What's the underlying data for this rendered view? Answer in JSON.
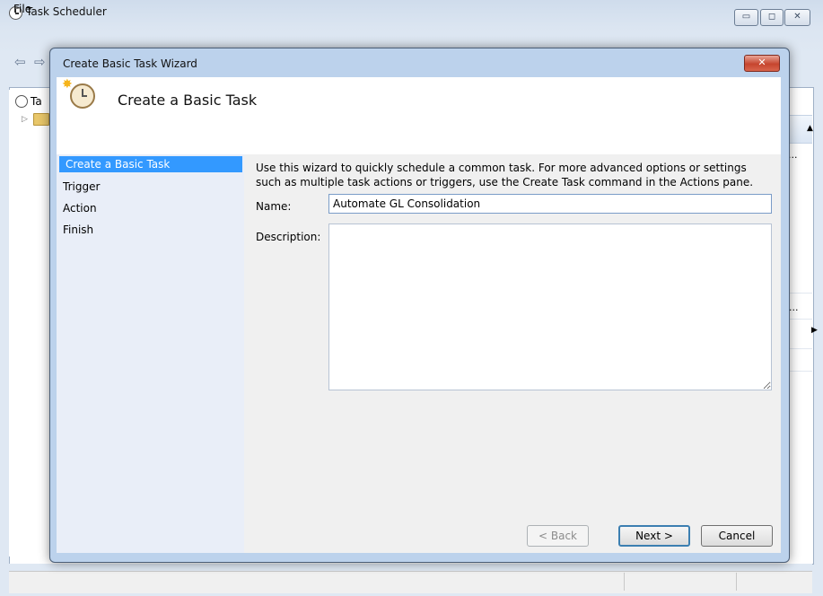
{
  "main_window": {
    "title": "Task Scheduler",
    "min_label": "▭",
    "max_label": "◻",
    "close_label": "✕",
    "menu": {
      "file": "File"
    },
    "tree": {
      "root_label": "Ta",
      "expander": "▷"
    },
    "actions": {
      "collapse": "▲",
      "ellipsis": "...",
      "submenu": "▶"
    }
  },
  "wizard": {
    "title": "Create Basic Task Wizard",
    "close_label": "✕",
    "header_title": "Create a Basic Task",
    "header_star": "✸",
    "nav": [
      {
        "label": "Create a Basic Task",
        "selected": true
      },
      {
        "label": "Trigger"
      },
      {
        "label": "Action"
      },
      {
        "label": "Finish"
      }
    ],
    "intro": "Use this wizard to quickly schedule a common task.  For more advanced options or settings such as multiple task actions or triggers, use the Create Task command in the Actions pane.",
    "name_label": "Name:",
    "name_value": "Automate GL Consolidation",
    "description_label": "Description:",
    "buttons": {
      "back": "< Back",
      "next": "Next >",
      "cancel": "Cancel"
    }
  },
  "colors": {
    "selection": "#3399ff",
    "dialog_frame": "#bcd2ec",
    "close_red": "#c6452e"
  }
}
